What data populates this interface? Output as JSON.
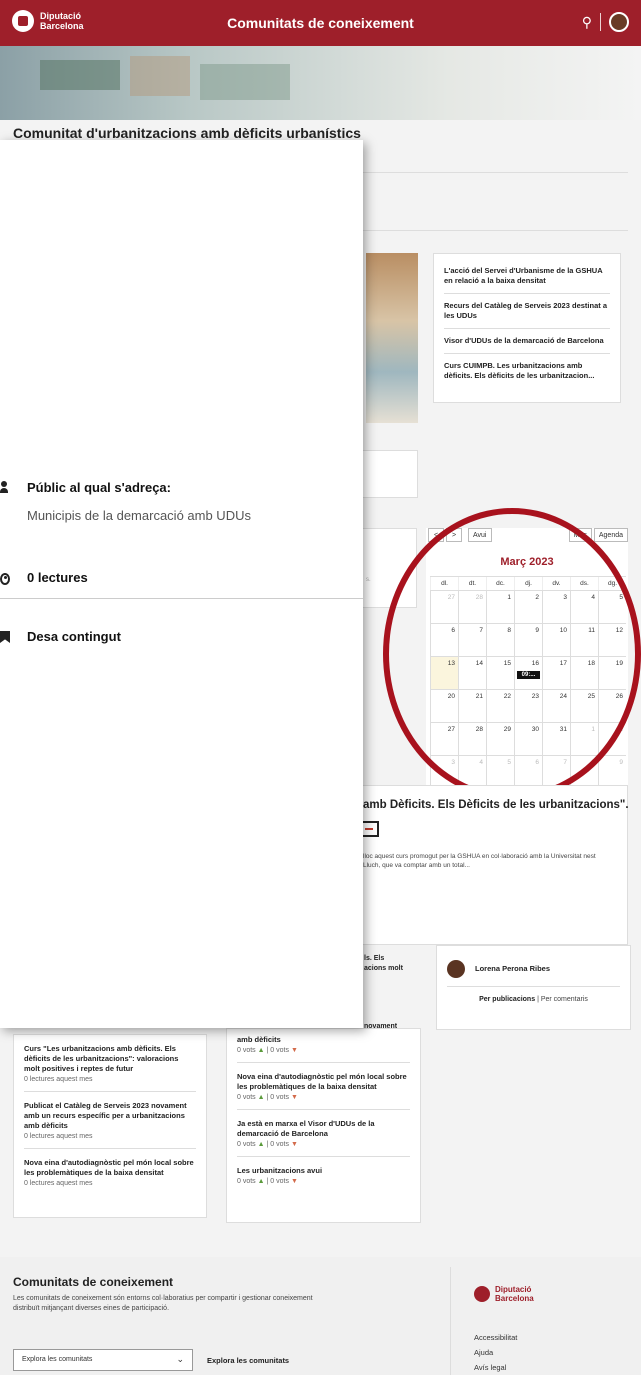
{
  "header": {
    "brand_line1": "Diputació",
    "brand_line2": "Barcelona",
    "title": "Comunitats de coneixement",
    "search_icon": "search-icon"
  },
  "page": {
    "title": "Comunitat d'urbanitzacions amb dèficits urbanístics"
  },
  "panel": {
    "public_label": "Públic al qual s'adreça:",
    "public_value": "Municipis de la demarcació amb UDUs",
    "reads": "0 lectures",
    "save": "Desa contingut"
  },
  "related_links": [
    "L'acció del Servei d'Urbanisme de la GSHUA en relació a la baixa densitat",
    "Recurs del Catàleg de Serveis 2023 destinat a les UDUs",
    "Visor d'UDUs de la demarcació de Barcelona",
    "Curs CUIMPB. Les urbanitzacions amb dèficits. Els dèficits de les urbanitzacion..."
  ],
  "calendar": {
    "prev": "<",
    "next": ">",
    "today": "Avui",
    "view_month": "Mes",
    "view_agenda": "Agenda",
    "month": "Març 2023",
    "weekdays": [
      "dl.",
      "dt.",
      "dc.",
      "dj.",
      "dv.",
      "ds.",
      "dg."
    ],
    "weeks": [
      [
        "27",
        "28",
        "1",
        "2",
        "3",
        "4",
        "5"
      ],
      [
        "6",
        "7",
        "8",
        "9",
        "10",
        "11",
        "12"
      ],
      [
        "13",
        "14",
        "15",
        "16",
        "17",
        "18",
        "19"
      ],
      [
        "20",
        "21",
        "22",
        "23",
        "24",
        "25",
        "26"
      ],
      [
        "27",
        "28",
        "29",
        "30",
        "31",
        "1",
        "2"
      ],
      [
        "3",
        "4",
        "5",
        "6",
        "7",
        "8",
        "9"
      ]
    ],
    "event_label": "09:..."
  },
  "event": {
    "title": "amb Dèficits. Els Dèficits de les urbanitzacions\".",
    "desc": "lloc aquest curs promogut per la GSHUA en col·laboració amb la Universitat nest Lluch, que va comptar amb un total..."
  },
  "author": {
    "name": "Lorena Perona Ribes",
    "tab_active": "Per publicacions",
    "tab_other": "Per comentaris"
  },
  "bg_snippets": {
    "a": "ls. Els",
    "b": "acions molt",
    "c": "novament",
    "d": "tzacions",
    "e": "amb dèficits",
    "f": "s."
  },
  "most_read": [
    {
      "title": "Curs \"Les urbanitzacions amb dèficits. Els dèficits de les urbanitzacions\": valoracions molt positives i reptes de futur",
      "meta": "0 lectures aquest mes"
    },
    {
      "title": "Publicat el Catàleg de Serveis 2023 novament amb un recurs específic per a urbanitzacions amb dèficits",
      "meta": "0 lectures aquest mes"
    },
    {
      "title": "Nova eina d'autodiagnòstic pel món local sobre les problemàtiques de la baixa densitat",
      "meta": "0 lectures aquest mes"
    }
  ],
  "most_voted": [
    {
      "title": "Nova eina d'autodiagnòstic pel món local sobre les problemàtiques de la baixa densitat",
      "votes_up": "0 vots",
      "votes_down": "| 0 vots"
    },
    {
      "title": "Ja està en marxa el Visor d'UDUs de la demarcació de Barcelona",
      "votes_up": "0 vots",
      "votes_down": "| 0 vots"
    },
    {
      "title": "Les urbanitzacions avui",
      "votes_up": "0 vots",
      "votes_down": "| 0 vots"
    }
  ],
  "first_voted_meta": {
    "votes_up": "0 vots",
    "votes_down": "| 0 vots"
  },
  "footer": {
    "title": "Comunitats de coneixement",
    "desc": "Les comunitats de coneixement són entorns col·laboratius per compartir i gestionar coneixement distribuït mitjançant diverses eines de participació.",
    "select_value": "Explora les comunitats",
    "explore_link": "Explora les comunitats",
    "brand_line1": "Diputació",
    "brand_line2": "Barcelona",
    "links": [
      "Accessibilitat",
      "Ajuda",
      "Avís legal"
    ]
  },
  "colors": {
    "brand": "#9e1f2a",
    "highlight_circle": "#a8121d"
  }
}
